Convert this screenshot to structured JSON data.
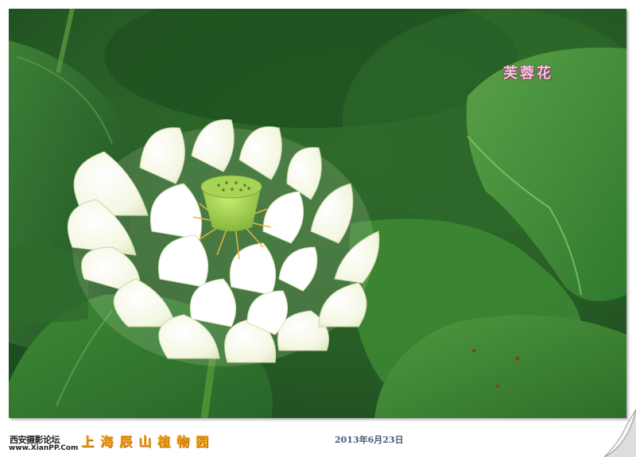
{
  "photo": {
    "title": "芙蓉花",
    "subject": "white-lotus-flower"
  },
  "footer": {
    "site_name": "西安摄影论坛",
    "site_url": "www.XianPP.Com",
    "location": "上海辰山植物园",
    "date": "2013年6月23日"
  },
  "colors": {
    "leaf_dark": "#1f5a22",
    "leaf_mid": "#3f8a35",
    "leaf_light": "#6fb054",
    "petal": "#f6f8e6",
    "seed_pod": "#9fd04a",
    "stamen": "#e8b830",
    "title_pink": "#f7c7e6",
    "location_orange": "#f0a01a",
    "date_blue": "#4a5a7a"
  }
}
